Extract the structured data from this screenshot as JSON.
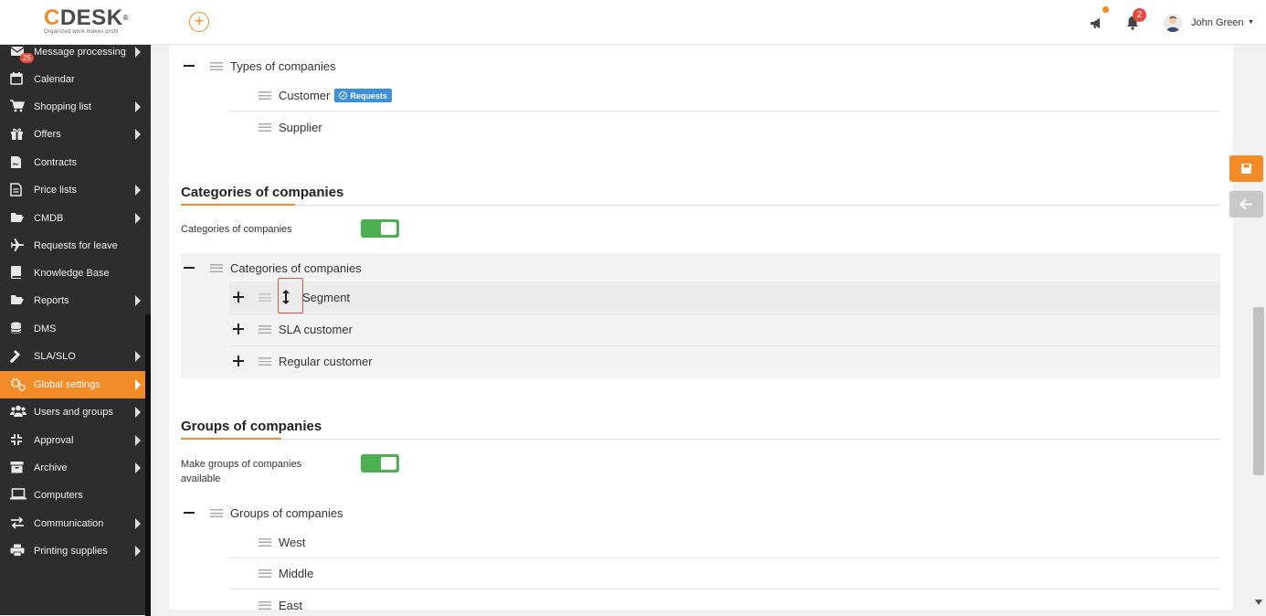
{
  "header": {
    "logo_text": "DESK",
    "logo_letter": "C",
    "logo_reg": "®",
    "logo_tagline": "Organized work makes profit",
    "add_symbol": "+",
    "notification_count": "2",
    "user_name": "John Green"
  },
  "sidebar": {
    "message_badge": "25",
    "items": [
      {
        "label": "Message processing"
      },
      {
        "label": "Calendar"
      },
      {
        "label": "Shopping list"
      },
      {
        "label": "Offers"
      },
      {
        "label": "Contracts"
      },
      {
        "label": "Price lists"
      },
      {
        "label": "CMDB"
      },
      {
        "label": "Requests for leave"
      },
      {
        "label": "Knowledge Base"
      },
      {
        "label": "Reports"
      },
      {
        "label": "DMS"
      },
      {
        "label": "SLA/SLO"
      },
      {
        "label": "Global settings"
      },
      {
        "label": "Users and groups"
      },
      {
        "label": "Approval"
      },
      {
        "label": "Archive"
      },
      {
        "label": "Computers"
      },
      {
        "label": "Communication"
      },
      {
        "label": "Printing supplies"
      }
    ]
  },
  "types": {
    "root_label": "Types of companies",
    "items": [
      {
        "label": "Customer",
        "badge": "Requests"
      },
      {
        "label": "Supplier"
      }
    ]
  },
  "categories": {
    "section_title": "Categories of companies",
    "toggle_label": "Categories of companies",
    "root_label": "Categories of companies",
    "items": [
      {
        "label": "Segment"
      },
      {
        "label": "SLA customer"
      },
      {
        "label": "Regular customer"
      }
    ]
  },
  "groups": {
    "section_title": "Groups of companies",
    "toggle_label_line1": "Make groups of companies",
    "toggle_label_line2": "available",
    "root_label": "Groups of companies",
    "items": [
      {
        "label": "West"
      },
      {
        "label": "Middle"
      },
      {
        "label": "East"
      }
    ]
  },
  "colors": {
    "accent": "#f28c28",
    "toggle_on": "#4caf50",
    "badge_blue": "#3d8fd6",
    "sidebar_bg": "#2d2d2d"
  }
}
